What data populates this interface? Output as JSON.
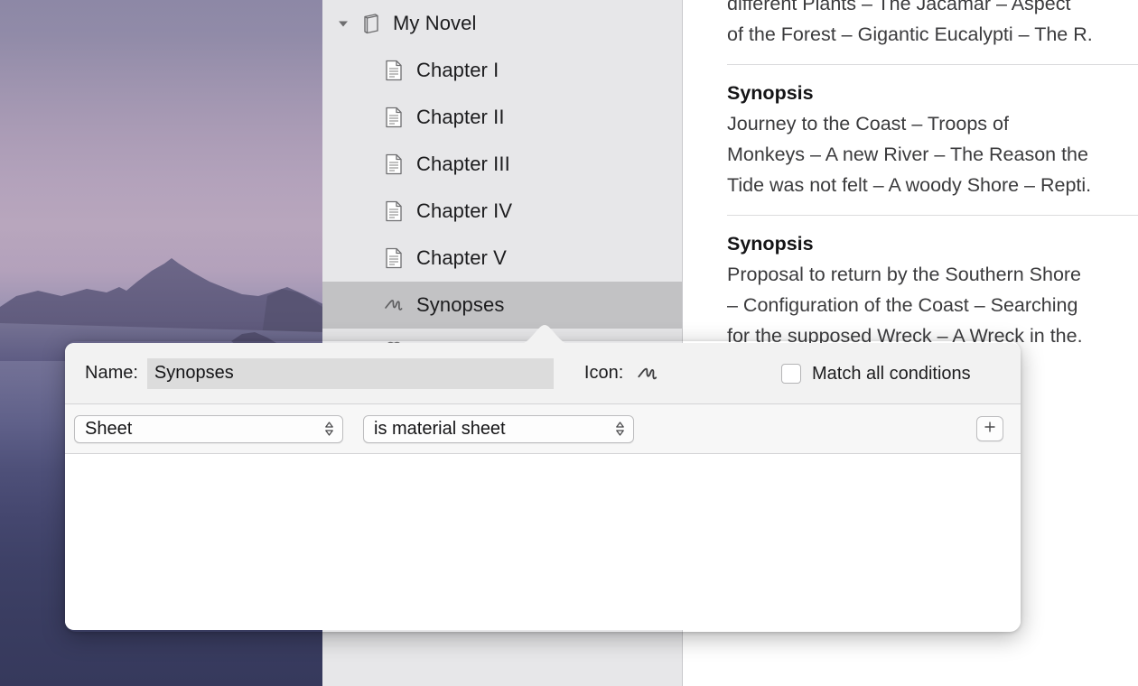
{
  "window": {
    "title": "My Novel"
  },
  "binder": {
    "root": {
      "label": "My Novel",
      "icon": "book-icon",
      "disclosure": "chevron-down-icon",
      "expanded": true
    },
    "items": [
      {
        "label": "Chapter I",
        "icon": "document-icon",
        "selected": false
      },
      {
        "label": "Chapter II",
        "icon": "document-icon",
        "selected": false
      },
      {
        "label": "Chapter III",
        "icon": "document-icon",
        "selected": false
      },
      {
        "label": "Chapter IV",
        "icon": "document-icon",
        "selected": false
      },
      {
        "label": "Chapter V",
        "icon": "document-icon",
        "selected": false
      },
      {
        "label": "Synopses",
        "icon": "scribble-icon",
        "selected": true
      },
      {
        "label": "",
        "icon": "knot-icon",
        "selected": false
      }
    ]
  },
  "editor": {
    "blocks": [
      {
        "heading": "",
        "lines": [
          "different Plants – The Jacamar – Aspect",
          "of the Forest – Gigantic Eucalypti – The R."
        ]
      },
      {
        "heading": "Synopsis",
        "lines": [
          "Journey to the Coast – Troops of",
          "Monkeys – A new River – The Reason the",
          "Tide was not felt – A woody Shore – Repti."
        ]
      },
      {
        "heading": "Synopsis",
        "lines": [
          "Proposal to return by the Southern Shore",
          "– Configuration of the Coast – Searching",
          "for the supposed Wreck – A Wreck in the."
        ]
      }
    ]
  },
  "popover": {
    "name_label": "Name:",
    "name_value": "Synopses",
    "name_placeholder": "Name",
    "icon_label": "Icon:",
    "icon_glyph": "scribble-icon",
    "match_all_label": "Match all conditions",
    "match_all_checked": false,
    "criteria": [
      {
        "scope": "Sheet",
        "condition": "is material sheet"
      }
    ],
    "add_label": "+"
  },
  "colors": {
    "sidebar_background": "#e7e7e9",
    "selection": "#c2c2c4",
    "popover_background": "#ffffff",
    "popover_header": "#f2f2f2",
    "name_field": "#dcdcdc",
    "editor_background": "#ffffff",
    "text": "#1c1c1e"
  }
}
